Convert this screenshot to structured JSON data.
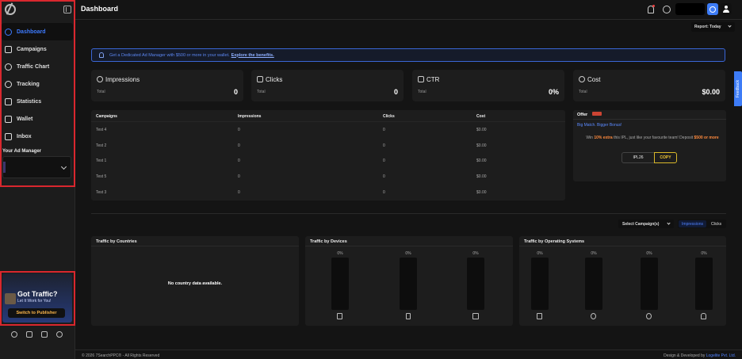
{
  "header": {
    "title": "Dashboard"
  },
  "sidebar": {
    "items": [
      {
        "label": "Dashboard"
      },
      {
        "label": "Campaigns"
      },
      {
        "label": "Traffic Chart"
      },
      {
        "label": "Tracking"
      },
      {
        "label": "Statistics"
      },
      {
        "label": "Wallet"
      },
      {
        "label": "Inbox"
      }
    ],
    "manager_label": "Your Ad Manager"
  },
  "promo": {
    "title": "Got Traffic?",
    "subtitle": "Let It Work for You!",
    "button": "Switch to Publisher"
  },
  "report": {
    "label": "Report: Today"
  },
  "feedback": "Feedback",
  "banner": {
    "text": "Get a Dedicated Ad Manager with $500 or more in your wallet.",
    "link": "Explore the benefits."
  },
  "cards": [
    {
      "title": "Impressions",
      "total_label": "Total",
      "value": "0"
    },
    {
      "title": "Clicks",
      "total_label": "Total",
      "value": "0"
    },
    {
      "title": "CTR",
      "total_label": "Total",
      "value": "0%"
    },
    {
      "title": "Cost",
      "total_label": "Total",
      "value": "$0.00"
    }
  ],
  "table": {
    "headers": [
      "Campaigns",
      "Impressions",
      "Clicks",
      "Cost"
    ],
    "rows": [
      [
        "Test 4",
        "0",
        "0",
        "$0.00"
      ],
      [
        "Test 2",
        "0",
        "0",
        "$0.00"
      ],
      [
        "Test 1",
        "0",
        "0",
        "$0.00"
      ],
      [
        "Test 5",
        "0",
        "0",
        "$0.00"
      ],
      [
        "Test 3",
        "0",
        "0",
        "$0.00"
      ]
    ]
  },
  "offer": {
    "label": "Offer",
    "tag": "Big Match. Bigger Bonus!",
    "text_1": "Win",
    "highlight_1": "10% extra",
    "text_2": "this IPL, just like your favourite team! Deposit",
    "highlight_2": "$500 or more",
    "code": "IPL26",
    "copy": "COPY"
  },
  "filters": {
    "select": "Select Campaign(s)",
    "impressions": "Impressions",
    "clicks": "Clicks"
  },
  "countries": {
    "title": "Traffic by Countries",
    "empty": "No country data available."
  },
  "devices": {
    "title": "Traffic by Devices",
    "pcts": [
      "0%",
      "0%",
      "0%"
    ]
  },
  "os": {
    "title": "Traffic by Operating Systems",
    "pcts": [
      "0%",
      "0%",
      "0%",
      "0%"
    ]
  },
  "footer": {
    "left": "© 2026 7SearchPPC® - All Rights Reserved",
    "right_prefix": "Design & Developed by",
    "company": "Logelite Pvt. Ltd."
  },
  "colors": {
    "accent": "#3d7cf7",
    "highlight_border": "#d9272e",
    "coupon_border": "#d9b82a",
    "offer_highlight": "#ff8a3d"
  }
}
